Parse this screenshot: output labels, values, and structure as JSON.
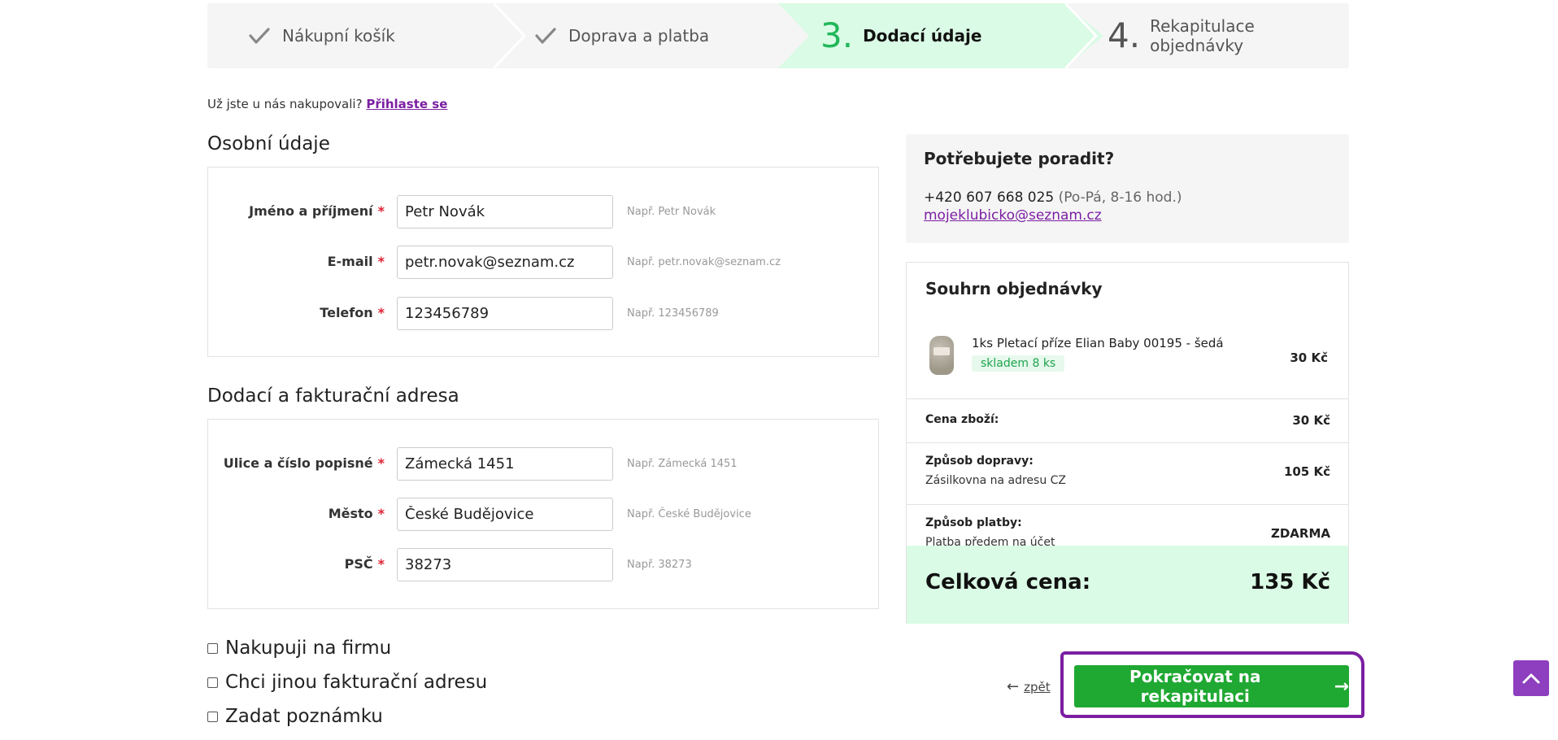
{
  "stepper": {
    "steps": [
      {
        "label": "Nákupní košík",
        "state": "done"
      },
      {
        "label": "Doprava a platba",
        "state": "done"
      },
      {
        "number": "3.",
        "label": "Dodací údaje",
        "state": "active"
      },
      {
        "number": "4.",
        "label": "Rekapitulace objednávky",
        "state": "pending"
      }
    ],
    "active_color": "#dafbe5",
    "accent_color": "#20b75a"
  },
  "login": {
    "question": "Už jste u nás nakupovali?",
    "link": "Přihlaste se"
  },
  "personal": {
    "title": "Osobní údaje",
    "fields": [
      {
        "label": "Jméno a příjmení",
        "required": "*",
        "value": "Petr Novák",
        "hint": "Např. Petr Novák"
      },
      {
        "label": "E-mail",
        "required": "*",
        "value": "petr.novak@seznam.cz",
        "hint": "Např. petr.novak@seznam.cz"
      },
      {
        "label": "Telefon",
        "required": "*",
        "value": "123456789",
        "hint": "Např. 123456789"
      }
    ]
  },
  "address": {
    "title": "Dodací a fakturační adresa",
    "fields": [
      {
        "label": "Ulice a číslo popisné",
        "required": "*",
        "value": "Zámecká 1451",
        "hint": "Např. Zámecká 1451"
      },
      {
        "label": "Město",
        "required": "*",
        "value": "České Budějovice",
        "hint": "Např. České Budějovice"
      },
      {
        "label": "PSČ",
        "required": "*",
        "value": "38273",
        "hint": "Např. 38273"
      }
    ]
  },
  "options": [
    {
      "label": "Nakupuji na firmu",
      "checked": false
    },
    {
      "label": "Chci jinou fakturační adresu",
      "checked": false
    },
    {
      "label": "Zadat poznámku",
      "checked": false
    }
  ],
  "help": {
    "title": "Potřebujete poradit?",
    "phone": "+420 607 668 025",
    "hours": "(Po-Pá, 8-16 hod.)",
    "email": "mojeklubicko@seznam.cz"
  },
  "summary": {
    "title": "Souhrn objednávky",
    "item": {
      "name": "1ks Pletací příze Elian Baby 00195 - šedá",
      "stock": "skladem 8 ks",
      "price": "30 Kč"
    },
    "goods": {
      "label": "Cena zboží:",
      "value": "30 Kč"
    },
    "shipping": {
      "label": "Způsob dopravy:",
      "detail": "Zásilkovna na adresu CZ",
      "value": "105 Kč"
    },
    "payment": {
      "label": "Způsob platby:",
      "detail": "Platba předem na účet",
      "value": "ZDARMA"
    },
    "total": {
      "label": "Celková cena:",
      "value": "135 Kč"
    }
  },
  "actions": {
    "back": "zpět",
    "continue": "Pokračovat na rekapitulaci",
    "button_color": "#1fa832",
    "highlight_color": "#7b1fa2"
  },
  "icons": {
    "done_step": "check-icon",
    "back": "arrow-left-icon",
    "continue": "arrow-right-icon",
    "scroll_top": "chevron-up-icon"
  }
}
